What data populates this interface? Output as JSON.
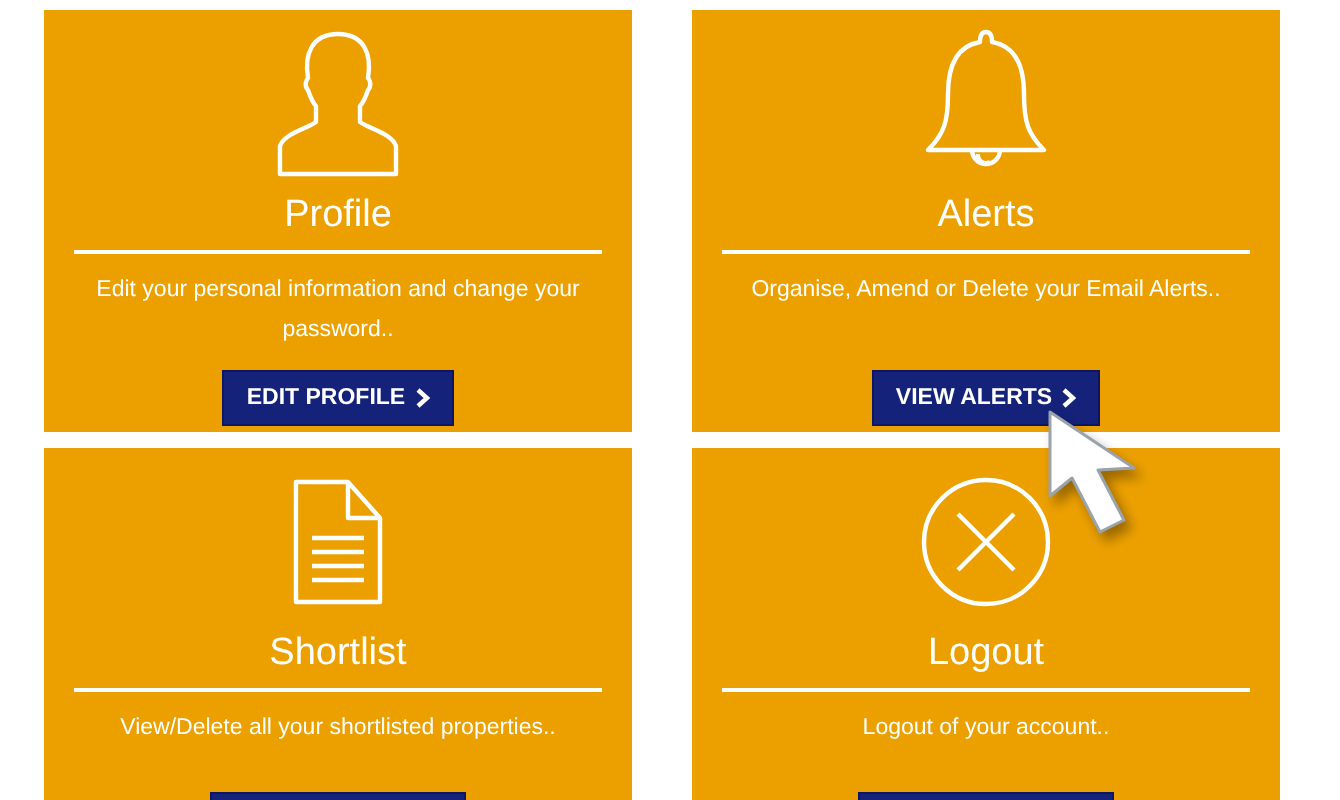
{
  "cards": [
    {
      "kind": "person",
      "title": "Profile",
      "description": "Edit your personal information and change your password..",
      "button": {
        "label": "EDIT PROFILE"
      },
      "hovered": false
    },
    {
      "kind": "bell",
      "title": "Alerts",
      "description": "Organise, Amend or Delete your Email Alerts..",
      "button": {
        "label": "VIEW ALERTS"
      },
      "hovered": true
    },
    {
      "kind": "document",
      "title": "Shortlist",
      "description": "View/Delete all your shortlisted properties..",
      "button_cut_off": true,
      "hovered": false
    },
    {
      "kind": "close",
      "title": "Logout",
      "description": "Logout of your account..",
      "button_cut_off": true,
      "hovered": false
    }
  ]
}
